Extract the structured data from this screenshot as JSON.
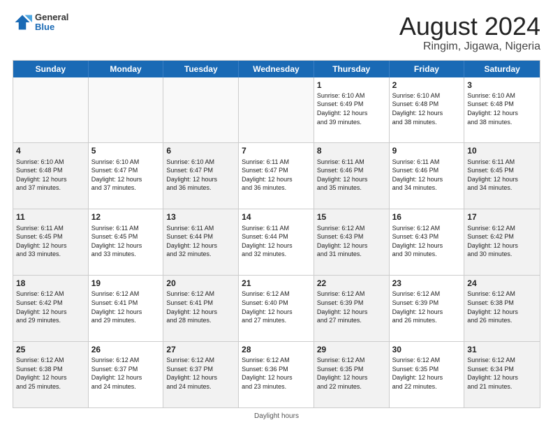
{
  "header": {
    "logo_general": "General",
    "logo_blue": "Blue",
    "title": "August 2024",
    "subtitle": "Ringim, Jigawa, Nigeria"
  },
  "weekdays": [
    "Sunday",
    "Monday",
    "Tuesday",
    "Wednesday",
    "Thursday",
    "Friday",
    "Saturday"
  ],
  "footer_text": "Daylight hours",
  "rows": [
    [
      {
        "day": "",
        "text": "",
        "shaded": true
      },
      {
        "day": "",
        "text": "",
        "shaded": true
      },
      {
        "day": "",
        "text": "",
        "shaded": true
      },
      {
        "day": "",
        "text": "",
        "shaded": true
      },
      {
        "day": "1",
        "text": "Sunrise: 6:10 AM\nSunset: 6:49 PM\nDaylight: 12 hours\nand 39 minutes.",
        "shaded": false
      },
      {
        "day": "2",
        "text": "Sunrise: 6:10 AM\nSunset: 6:48 PM\nDaylight: 12 hours\nand 38 minutes.",
        "shaded": false
      },
      {
        "day": "3",
        "text": "Sunrise: 6:10 AM\nSunset: 6:48 PM\nDaylight: 12 hours\nand 38 minutes.",
        "shaded": false
      }
    ],
    [
      {
        "day": "4",
        "text": "Sunrise: 6:10 AM\nSunset: 6:48 PM\nDaylight: 12 hours\nand 37 minutes.",
        "shaded": true
      },
      {
        "day": "5",
        "text": "Sunrise: 6:10 AM\nSunset: 6:47 PM\nDaylight: 12 hours\nand 37 minutes.",
        "shaded": false
      },
      {
        "day": "6",
        "text": "Sunrise: 6:10 AM\nSunset: 6:47 PM\nDaylight: 12 hours\nand 36 minutes.",
        "shaded": true
      },
      {
        "day": "7",
        "text": "Sunrise: 6:11 AM\nSunset: 6:47 PM\nDaylight: 12 hours\nand 36 minutes.",
        "shaded": false
      },
      {
        "day": "8",
        "text": "Sunrise: 6:11 AM\nSunset: 6:46 PM\nDaylight: 12 hours\nand 35 minutes.",
        "shaded": true
      },
      {
        "day": "9",
        "text": "Sunrise: 6:11 AM\nSunset: 6:46 PM\nDaylight: 12 hours\nand 34 minutes.",
        "shaded": false
      },
      {
        "day": "10",
        "text": "Sunrise: 6:11 AM\nSunset: 6:45 PM\nDaylight: 12 hours\nand 34 minutes.",
        "shaded": true
      }
    ],
    [
      {
        "day": "11",
        "text": "Sunrise: 6:11 AM\nSunset: 6:45 PM\nDaylight: 12 hours\nand 33 minutes.",
        "shaded": true
      },
      {
        "day": "12",
        "text": "Sunrise: 6:11 AM\nSunset: 6:45 PM\nDaylight: 12 hours\nand 33 minutes.",
        "shaded": false
      },
      {
        "day": "13",
        "text": "Sunrise: 6:11 AM\nSunset: 6:44 PM\nDaylight: 12 hours\nand 32 minutes.",
        "shaded": true
      },
      {
        "day": "14",
        "text": "Sunrise: 6:11 AM\nSunset: 6:44 PM\nDaylight: 12 hours\nand 32 minutes.",
        "shaded": false
      },
      {
        "day": "15",
        "text": "Sunrise: 6:12 AM\nSunset: 6:43 PM\nDaylight: 12 hours\nand 31 minutes.",
        "shaded": true
      },
      {
        "day": "16",
        "text": "Sunrise: 6:12 AM\nSunset: 6:43 PM\nDaylight: 12 hours\nand 30 minutes.",
        "shaded": false
      },
      {
        "day": "17",
        "text": "Sunrise: 6:12 AM\nSunset: 6:42 PM\nDaylight: 12 hours\nand 30 minutes.",
        "shaded": true
      }
    ],
    [
      {
        "day": "18",
        "text": "Sunrise: 6:12 AM\nSunset: 6:42 PM\nDaylight: 12 hours\nand 29 minutes.",
        "shaded": true
      },
      {
        "day": "19",
        "text": "Sunrise: 6:12 AM\nSunset: 6:41 PM\nDaylight: 12 hours\nand 29 minutes.",
        "shaded": false
      },
      {
        "day": "20",
        "text": "Sunrise: 6:12 AM\nSunset: 6:41 PM\nDaylight: 12 hours\nand 28 minutes.",
        "shaded": true
      },
      {
        "day": "21",
        "text": "Sunrise: 6:12 AM\nSunset: 6:40 PM\nDaylight: 12 hours\nand 27 minutes.",
        "shaded": false
      },
      {
        "day": "22",
        "text": "Sunrise: 6:12 AM\nSunset: 6:39 PM\nDaylight: 12 hours\nand 27 minutes.",
        "shaded": true
      },
      {
        "day": "23",
        "text": "Sunrise: 6:12 AM\nSunset: 6:39 PM\nDaylight: 12 hours\nand 26 minutes.",
        "shaded": false
      },
      {
        "day": "24",
        "text": "Sunrise: 6:12 AM\nSunset: 6:38 PM\nDaylight: 12 hours\nand 26 minutes.",
        "shaded": true
      }
    ],
    [
      {
        "day": "25",
        "text": "Sunrise: 6:12 AM\nSunset: 6:38 PM\nDaylight: 12 hours\nand 25 minutes.",
        "shaded": true
      },
      {
        "day": "26",
        "text": "Sunrise: 6:12 AM\nSunset: 6:37 PM\nDaylight: 12 hours\nand 24 minutes.",
        "shaded": false
      },
      {
        "day": "27",
        "text": "Sunrise: 6:12 AM\nSunset: 6:37 PM\nDaylight: 12 hours\nand 24 minutes.",
        "shaded": true
      },
      {
        "day": "28",
        "text": "Sunrise: 6:12 AM\nSunset: 6:36 PM\nDaylight: 12 hours\nand 23 minutes.",
        "shaded": false
      },
      {
        "day": "29",
        "text": "Sunrise: 6:12 AM\nSunset: 6:35 PM\nDaylight: 12 hours\nand 22 minutes.",
        "shaded": true
      },
      {
        "day": "30",
        "text": "Sunrise: 6:12 AM\nSunset: 6:35 PM\nDaylight: 12 hours\nand 22 minutes.",
        "shaded": false
      },
      {
        "day": "31",
        "text": "Sunrise: 6:12 AM\nSunset: 6:34 PM\nDaylight: 12 hours\nand 21 minutes.",
        "shaded": true
      }
    ]
  ]
}
